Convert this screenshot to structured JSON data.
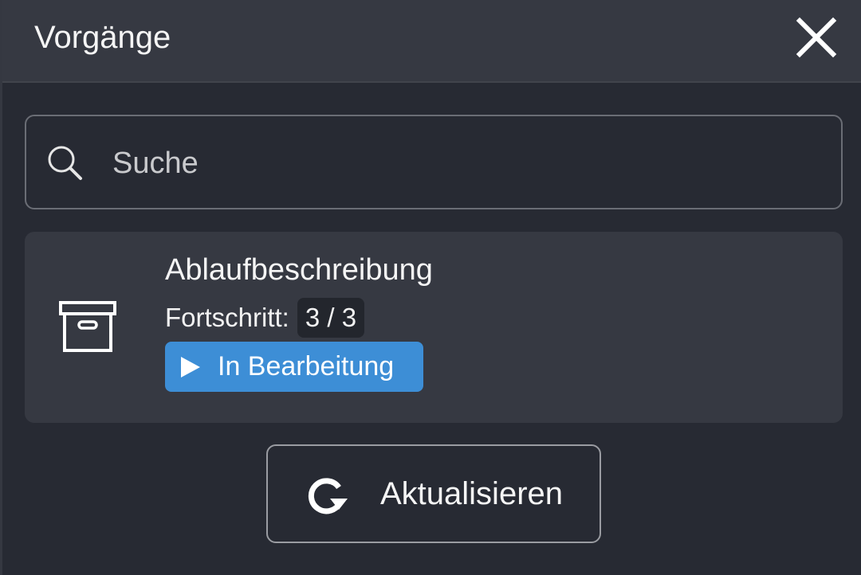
{
  "header": {
    "title": "Vorgänge",
    "close_icon": "close-icon"
  },
  "search": {
    "placeholder": "Suche",
    "value": "",
    "icon": "search-icon"
  },
  "processes": [
    {
      "title": "Ablaufbeschreibung",
      "icon": "archive-box-icon",
      "progress_label": "Fortschritt:",
      "progress_value": "3 / 3",
      "status": {
        "label": "In Bearbeitung",
        "icon": "play-icon",
        "color": "#3d8ed6"
      }
    }
  ],
  "actions": {
    "refresh_label": "Aktualisieren",
    "refresh_icon": "refresh-icon"
  },
  "colors": {
    "background": "#272a33",
    "header": "#363942",
    "card": "#363942",
    "accent": "#3d8ed6"
  }
}
